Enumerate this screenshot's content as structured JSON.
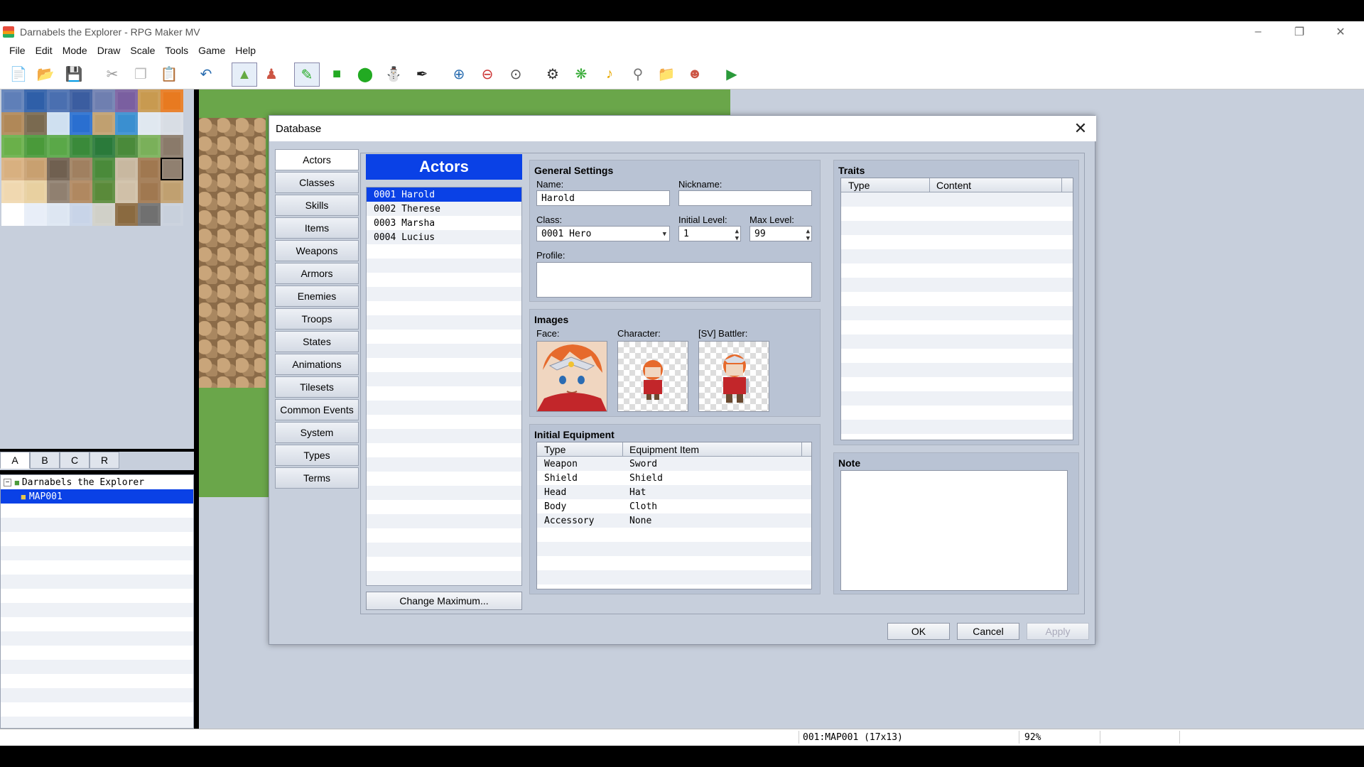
{
  "window": {
    "title": "Darnabels the Explorer - RPG Maker MV"
  },
  "menu": [
    "File",
    "Edit",
    "Mode",
    "Draw",
    "Scale",
    "Tools",
    "Game",
    "Help"
  ],
  "tile_tabs": [
    "A",
    "B",
    "C",
    "R"
  ],
  "map_tree": {
    "project": "Darnabels the Explorer",
    "map": "MAP001"
  },
  "status": {
    "map_info": "001:MAP001 (17x13)",
    "zoom": "92%"
  },
  "dialog": {
    "title": "Database",
    "categories": [
      "Actors",
      "Classes",
      "Skills",
      "Items",
      "Weapons",
      "Armors",
      "Enemies",
      "Troops",
      "States",
      "Animations",
      "Tilesets",
      "Common Events",
      "System",
      "Types",
      "Terms"
    ],
    "list_header": "Actors",
    "actors": [
      "0001 Harold",
      "0002 Therese",
      "0003 Marsha",
      "0004 Lucius"
    ],
    "change_max_label": "Change Maximum...",
    "general": {
      "title": "General Settings",
      "name_label": "Name:",
      "name_value": "Harold",
      "nickname_label": "Nickname:",
      "nickname_value": "",
      "class_label": "Class:",
      "class_value": "0001 Hero",
      "init_level_label": "Initial Level:",
      "init_level_value": "1",
      "max_level_label": "Max Level:",
      "max_level_value": "99",
      "profile_label": "Profile:",
      "profile_value": ""
    },
    "images": {
      "title": "Images",
      "face_label": "Face:",
      "character_label": "Character:",
      "battler_label": "[SV] Battler:"
    },
    "equipment": {
      "title": "Initial Equipment",
      "col_type": "Type",
      "col_item": "Equipment Item",
      "rows": [
        {
          "type": "Weapon",
          "item": "Sword"
        },
        {
          "type": "Shield",
          "item": "Shield"
        },
        {
          "type": "Head",
          "item": "Hat"
        },
        {
          "type": "Body",
          "item": "Cloth"
        },
        {
          "type": "Accessory",
          "item": "None"
        }
      ]
    },
    "traits": {
      "title": "Traits",
      "col_type": "Type",
      "col_content": "Content"
    },
    "note": {
      "title": "Note",
      "value": ""
    },
    "buttons": {
      "ok": "OK",
      "cancel": "Cancel",
      "apply": "Apply"
    }
  },
  "colors": {
    "selection": "#0a41e6",
    "panel_bg": "#c7cfdc",
    "grass": "#6aa64a"
  }
}
